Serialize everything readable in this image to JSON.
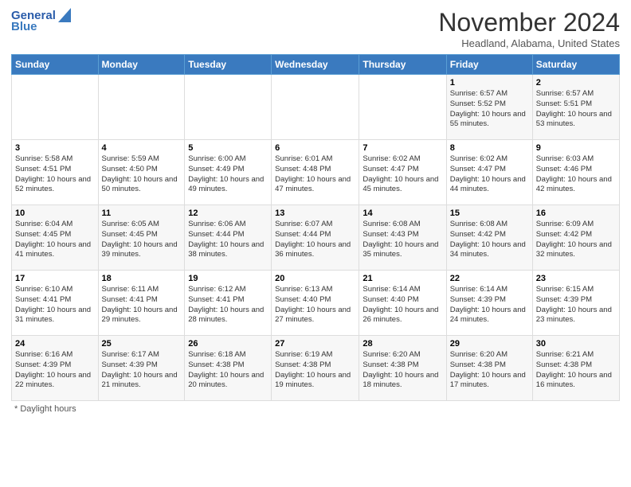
{
  "header": {
    "logo_line1": "General",
    "logo_line2": "Blue",
    "title": "November 2024",
    "location": "Headland, Alabama, United States"
  },
  "days_of_week": [
    "Sunday",
    "Monday",
    "Tuesday",
    "Wednesday",
    "Thursday",
    "Friday",
    "Saturday"
  ],
  "weeks": [
    [
      {
        "day": "",
        "info": ""
      },
      {
        "day": "",
        "info": ""
      },
      {
        "day": "",
        "info": ""
      },
      {
        "day": "",
        "info": ""
      },
      {
        "day": "",
        "info": ""
      },
      {
        "day": "1",
        "info": "Sunrise: 6:57 AM\nSunset: 5:52 PM\nDaylight: 10 hours\nand 55 minutes."
      },
      {
        "day": "2",
        "info": "Sunrise: 6:57 AM\nSunset: 5:51 PM\nDaylight: 10 hours\nand 53 minutes."
      }
    ],
    [
      {
        "day": "3",
        "info": "Sunrise: 5:58 AM\nSunset: 4:51 PM\nDaylight: 10 hours\nand 52 minutes."
      },
      {
        "day": "4",
        "info": "Sunrise: 5:59 AM\nSunset: 4:50 PM\nDaylight: 10 hours\nand 50 minutes."
      },
      {
        "day": "5",
        "info": "Sunrise: 6:00 AM\nSunset: 4:49 PM\nDaylight: 10 hours\nand 49 minutes."
      },
      {
        "day": "6",
        "info": "Sunrise: 6:01 AM\nSunset: 4:48 PM\nDaylight: 10 hours\nand 47 minutes."
      },
      {
        "day": "7",
        "info": "Sunrise: 6:02 AM\nSunset: 4:47 PM\nDaylight: 10 hours\nand 45 minutes."
      },
      {
        "day": "8",
        "info": "Sunrise: 6:02 AM\nSunset: 4:47 PM\nDaylight: 10 hours\nand 44 minutes."
      },
      {
        "day": "9",
        "info": "Sunrise: 6:03 AM\nSunset: 4:46 PM\nDaylight: 10 hours\nand 42 minutes."
      }
    ],
    [
      {
        "day": "10",
        "info": "Sunrise: 6:04 AM\nSunset: 4:45 PM\nDaylight: 10 hours\nand 41 minutes."
      },
      {
        "day": "11",
        "info": "Sunrise: 6:05 AM\nSunset: 4:45 PM\nDaylight: 10 hours\nand 39 minutes."
      },
      {
        "day": "12",
        "info": "Sunrise: 6:06 AM\nSunset: 4:44 PM\nDaylight: 10 hours\nand 38 minutes."
      },
      {
        "day": "13",
        "info": "Sunrise: 6:07 AM\nSunset: 4:44 PM\nDaylight: 10 hours\nand 36 minutes."
      },
      {
        "day": "14",
        "info": "Sunrise: 6:08 AM\nSunset: 4:43 PM\nDaylight: 10 hours\nand 35 minutes."
      },
      {
        "day": "15",
        "info": "Sunrise: 6:08 AM\nSunset: 4:42 PM\nDaylight: 10 hours\nand 34 minutes."
      },
      {
        "day": "16",
        "info": "Sunrise: 6:09 AM\nSunset: 4:42 PM\nDaylight: 10 hours\nand 32 minutes."
      }
    ],
    [
      {
        "day": "17",
        "info": "Sunrise: 6:10 AM\nSunset: 4:41 PM\nDaylight: 10 hours\nand 31 minutes."
      },
      {
        "day": "18",
        "info": "Sunrise: 6:11 AM\nSunset: 4:41 PM\nDaylight: 10 hours\nand 29 minutes."
      },
      {
        "day": "19",
        "info": "Sunrise: 6:12 AM\nSunset: 4:41 PM\nDaylight: 10 hours\nand 28 minutes."
      },
      {
        "day": "20",
        "info": "Sunrise: 6:13 AM\nSunset: 4:40 PM\nDaylight: 10 hours\nand 27 minutes."
      },
      {
        "day": "21",
        "info": "Sunrise: 6:14 AM\nSunset: 4:40 PM\nDaylight: 10 hours\nand 26 minutes."
      },
      {
        "day": "22",
        "info": "Sunrise: 6:14 AM\nSunset: 4:39 PM\nDaylight: 10 hours\nand 24 minutes."
      },
      {
        "day": "23",
        "info": "Sunrise: 6:15 AM\nSunset: 4:39 PM\nDaylight: 10 hours\nand 23 minutes."
      }
    ],
    [
      {
        "day": "24",
        "info": "Sunrise: 6:16 AM\nSunset: 4:39 PM\nDaylight: 10 hours\nand 22 minutes."
      },
      {
        "day": "25",
        "info": "Sunrise: 6:17 AM\nSunset: 4:39 PM\nDaylight: 10 hours\nand 21 minutes."
      },
      {
        "day": "26",
        "info": "Sunrise: 6:18 AM\nSunset: 4:38 PM\nDaylight: 10 hours\nand 20 minutes."
      },
      {
        "day": "27",
        "info": "Sunrise: 6:19 AM\nSunset: 4:38 PM\nDaylight: 10 hours\nand 19 minutes."
      },
      {
        "day": "28",
        "info": "Sunrise: 6:20 AM\nSunset: 4:38 PM\nDaylight: 10 hours\nand 18 minutes."
      },
      {
        "day": "29",
        "info": "Sunrise: 6:20 AM\nSunset: 4:38 PM\nDaylight: 10 hours\nand 17 minutes."
      },
      {
        "day": "30",
        "info": "Sunrise: 6:21 AM\nSunset: 4:38 PM\nDaylight: 10 hours\nand 16 minutes."
      }
    ]
  ],
  "footer": "Daylight hours"
}
